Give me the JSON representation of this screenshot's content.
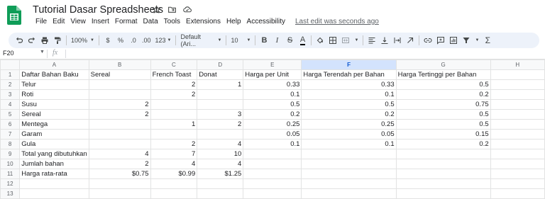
{
  "app": {
    "title": "Tutorial Dasar Spreadsheets",
    "menu": [
      "File",
      "Edit",
      "View",
      "Insert",
      "Format",
      "Data",
      "Tools",
      "Extensions",
      "Help",
      "Accessibility"
    ],
    "last_edit": "Last edit was seconds ago",
    "brand_color": "#0f9d58"
  },
  "toolbar": {
    "zoom": "100%",
    "currency": "$",
    "percent": "%",
    "dec_decrease": ".0",
    "dec_increase": ".00",
    "more_formats": "123",
    "font": "Default (Ari...",
    "font_size": "10",
    "bold": "B",
    "italic": "I",
    "strike": "S",
    "text_color": "A"
  },
  "formula": {
    "cell_ref": "F20",
    "fx": "fx",
    "value": ""
  },
  "sheet": {
    "columns": [
      "A",
      "B",
      "C",
      "D",
      "E",
      "F",
      "G",
      "H"
    ],
    "selected_column": "F",
    "rows": [
      {
        "n": "1",
        "cells": [
          "Daftar Bahan Baku",
          "Sereal",
          "French Toast",
          "Donat",
          "Harga per Unit",
          "Harga Terendah per Bahan",
          "Harga Tertinggi per Bahan",
          ""
        ]
      },
      {
        "n": "2",
        "cells": [
          "Telur",
          "",
          "2",
          "1",
          "0.33",
          "0.33",
          "0.5",
          ""
        ]
      },
      {
        "n": "3",
        "cells": [
          "Roti",
          "",
          "2",
          "",
          "0.1",
          "0.1",
          "0.2",
          ""
        ]
      },
      {
        "n": "4",
        "cells": [
          "Susu",
          "2",
          "",
          "",
          "0.5",
          "0.5",
          "0.75",
          ""
        ]
      },
      {
        "n": "5",
        "cells": [
          "Sereal",
          "2",
          "",
          "3",
          "0.2",
          "0.2",
          "0.5",
          ""
        ]
      },
      {
        "n": "6",
        "cells": [
          "Mentega",
          "",
          "1",
          "2",
          "0.25",
          "0.25",
          "0.5",
          ""
        ]
      },
      {
        "n": "7",
        "cells": [
          "Garam",
          "",
          "",
          "",
          "0.05",
          "0.05",
          "0.15",
          ""
        ]
      },
      {
        "n": "8",
        "cells": [
          "Gula",
          "",
          "2",
          "4",
          "0.1",
          "0.1",
          "0.2",
          ""
        ]
      },
      {
        "n": "9",
        "cells": [
          "Total yang dibutuhkan",
          "4",
          "7",
          "10",
          "",
          "",
          "",
          ""
        ]
      },
      {
        "n": "10",
        "cells": [
          "Jumlah bahan",
          "2",
          "4",
          "4",
          "",
          "",
          "",
          ""
        ]
      },
      {
        "n": "11",
        "cells": [
          "Harga rata-rata",
          "$0.75",
          "$0.99",
          "$1.25",
          "",
          "",
          "",
          ""
        ]
      },
      {
        "n": "12",
        "cells": [
          "",
          "",
          "",
          "",
          "",
          "",
          "",
          ""
        ]
      },
      {
        "n": "13",
        "cells": [
          "",
          "",
          "",
          "",
          "",
          "",
          "",
          ""
        ]
      }
    ]
  }
}
